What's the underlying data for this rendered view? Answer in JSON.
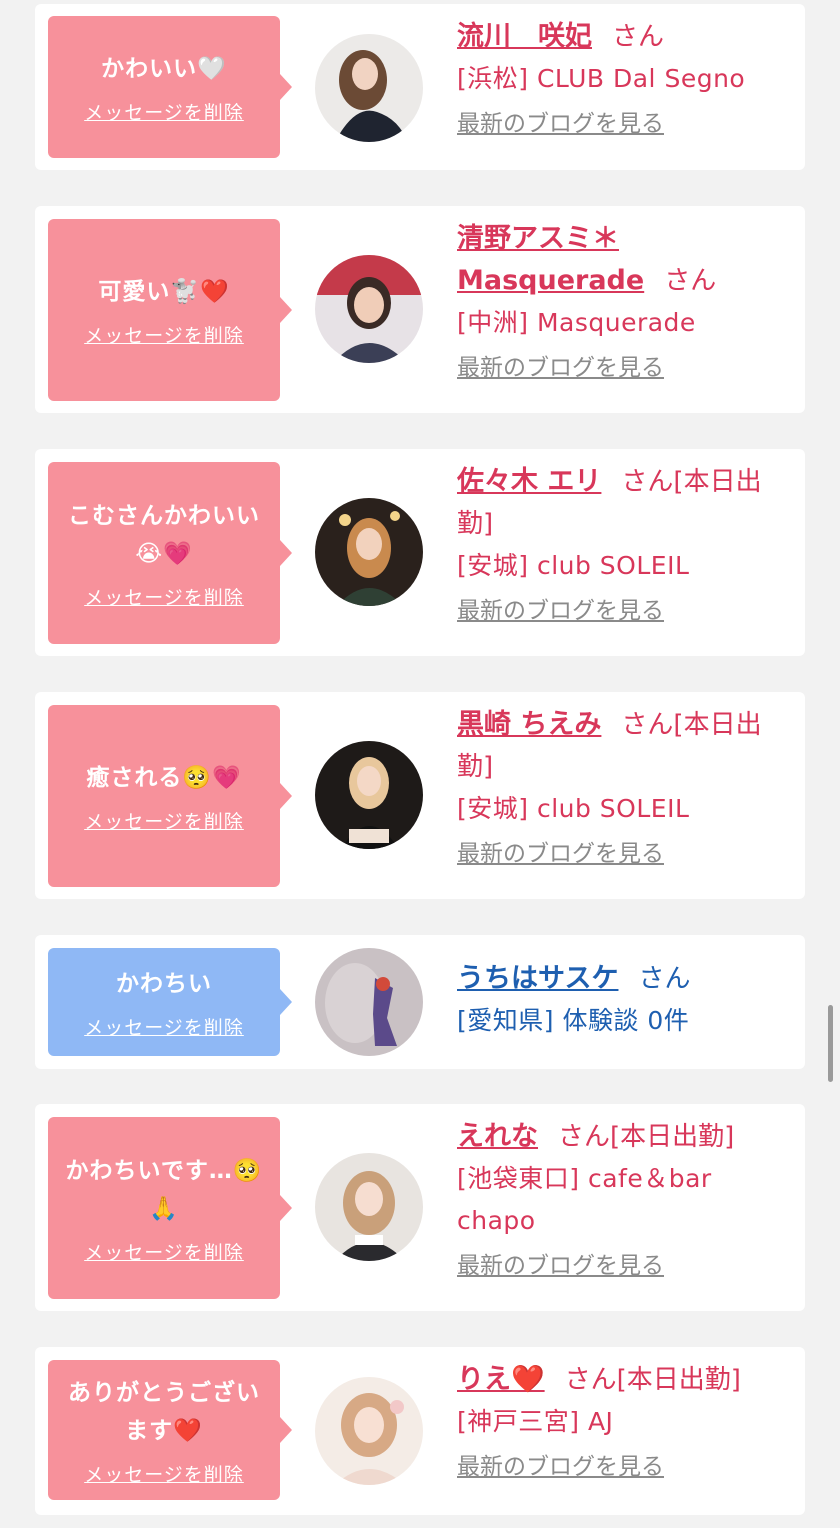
{
  "suffix_san": "さん",
  "delete_label": "メッセージを削除",
  "blog_label": "最新のブログを見る",
  "colors": {
    "pink_bubble": "#f7919b",
    "blue_bubble": "#8fb8f5",
    "pink_text": "#d8375a",
    "blue_text": "#1e5fb0"
  },
  "cards": [
    {
      "message": "かわいい🤍",
      "name": "流川　咲妃",
      "status": "",
      "shop": "[浜松] CLUB Dal Segno",
      "blog": true,
      "bubble_color": "pink"
    },
    {
      "message": "可愛い🐩❤️",
      "name": "清野アスミ＊Masquerade",
      "status": "",
      "shop": "[中洲] Masquerade",
      "blog": true,
      "bubble_color": "pink"
    },
    {
      "message": "こむさんかわいい😭💗",
      "name": "佐々木 エリ",
      "status": "[本日出勤]",
      "shop": "[安城] club SOLEIL",
      "blog": true,
      "bubble_color": "pink"
    },
    {
      "message": "癒される🥺💗",
      "name": "黒崎 ちえみ",
      "status": "[本日出勤]",
      "shop": "[安城] club SOLEIL",
      "blog": true,
      "bubble_color": "pink"
    },
    {
      "message": "かわちい",
      "name": "うちはサスケ",
      "status": "",
      "shop": "[愛知県] 体験談 0件",
      "blog": false,
      "bubble_color": "blue"
    },
    {
      "message": "かわちいです…🥺🙏",
      "name": "えれな",
      "status": "[本日出勤]",
      "shop": "[池袋東口] cafe＆bar chapo",
      "blog": true,
      "bubble_color": "pink"
    },
    {
      "message": "ありがとうございます❤️",
      "name": "りえ❤️",
      "status": "[本日出勤]",
      "shop": "[神戸三宮] AJ",
      "blog": true,
      "bubble_color": "pink"
    }
  ]
}
